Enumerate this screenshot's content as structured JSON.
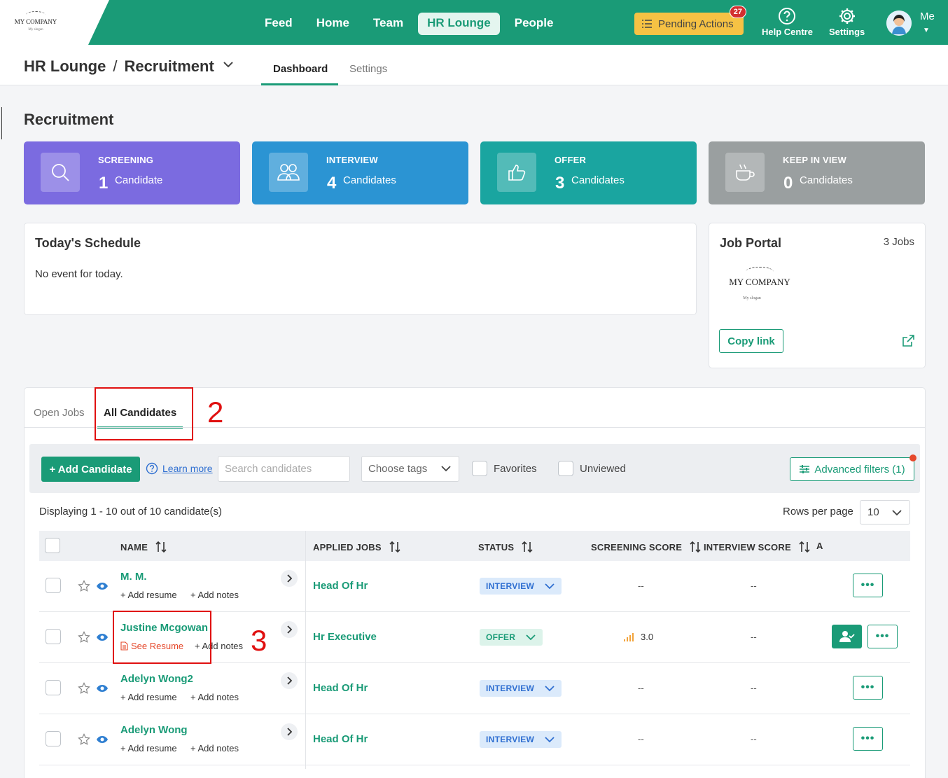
{
  "logo": {
    "text": "MY COMPANY",
    "sub": "My slogan"
  },
  "nav": {
    "items": [
      "Feed",
      "Home",
      "Team",
      "HR Lounge",
      "People"
    ],
    "active": "HR Lounge"
  },
  "pending": {
    "label": "Pending Actions",
    "count": "27"
  },
  "help": {
    "label": "Help Centre"
  },
  "settings": {
    "label": "Settings"
  },
  "user": {
    "label": "Me"
  },
  "breadcrumb": {
    "root": "HR Lounge",
    "separator": "/",
    "current": "Recruitment"
  },
  "subtabs": {
    "dashboard": "Dashboard",
    "settings": "Settings"
  },
  "page": {
    "title": "Recruitment"
  },
  "stats": [
    {
      "label": "SCREENING",
      "count": "1",
      "unit": "Candidate",
      "color": "#7b6be0",
      "icon": "search-icon"
    },
    {
      "label": "INTERVIEW",
      "count": "4",
      "unit": "Candidates",
      "color": "#2b94d3",
      "icon": "people-icon"
    },
    {
      "label": "OFFER",
      "count": "3",
      "unit": "Candidates",
      "color": "#1aa5a0",
      "icon": "thumbs-up-icon"
    },
    {
      "label": "KEEP IN VIEW",
      "count": "0",
      "unit": "Candidates",
      "color": "#9a9fa0",
      "icon": "coffee-cup-icon"
    }
  ],
  "schedule": {
    "title": "Today's Schedule",
    "empty": "No event for today."
  },
  "portal": {
    "title": "Job Portal",
    "jobs": "3 Jobs",
    "logo_text": "MY COMPANY",
    "logo_sub": "My slogan",
    "copy_label": "Copy link"
  },
  "candidate_tabs": {
    "open_jobs": "Open Jobs",
    "all_candidates": "All Candidates"
  },
  "annotations": {
    "step2": "2",
    "step3": "3"
  },
  "toolbar": {
    "add_label": "+ Add Candidate",
    "learn_more": "Learn more",
    "search_placeholder": "Search candidates",
    "tags_placeholder": "Choose tags",
    "favorites": "Favorites",
    "unviewed": "Unviewed",
    "advanced": "Advanced filters (1)"
  },
  "listing": {
    "displaying": "Displaying 1 - 10 out of 10 candidate(s)",
    "rows_label": "Rows per page",
    "rows_value": "10"
  },
  "table": {
    "headers": {
      "name": "NAME",
      "jobs": "APPLIED JOBS",
      "status": "STATUS",
      "screening": "SCREENING SCORE",
      "interview": "INTERVIEW SCORE",
      "extra": "A"
    },
    "rows": [
      {
        "name": "M. M.",
        "action1": "+ Add resume",
        "action2": "+ Add notes",
        "job": "Head Of Hr",
        "status": "INTERVIEW",
        "screening": "--",
        "interview": "--"
      },
      {
        "name": "Justine Mcgowan",
        "action1": "See Resume",
        "action2": "+ Add notes",
        "job": "Hr Executive",
        "status": "OFFER",
        "screening": "3.0",
        "interview": "--"
      },
      {
        "name": "Adelyn Wong2",
        "action1": "+ Add resume",
        "action2": "+ Add notes",
        "job": "Head Of Hr",
        "status": "INTERVIEW",
        "screening": "--",
        "interview": "--"
      },
      {
        "name": "Adelyn Wong",
        "action1": "+ Add resume",
        "action2": "+ Add notes",
        "job": "Head Of Hr",
        "status": "INTERVIEW",
        "screening": "--",
        "interview": "--"
      }
    ]
  },
  "colors": {
    "brand": "#1a9b77",
    "annotation": "#e01010",
    "pending": "#f6c244"
  }
}
